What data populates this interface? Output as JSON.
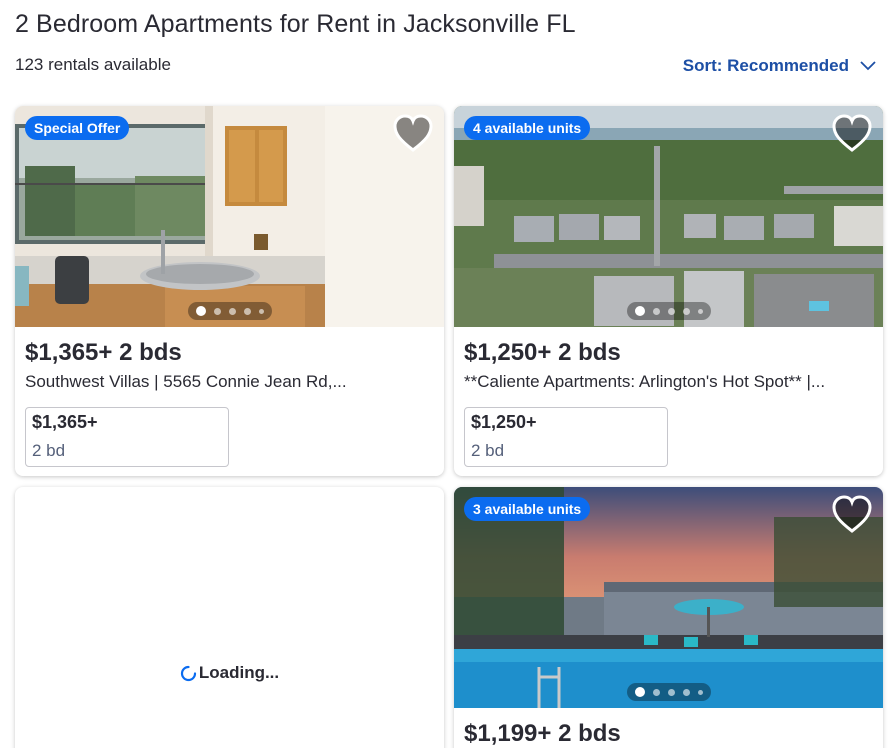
{
  "header": {
    "title": "2 Bedroom Apartments for Rent in Jacksonville FL",
    "results_count": "123 rentals available",
    "sort_label": "Sort: Recommended"
  },
  "listings": [
    {
      "badge": "Special Offer",
      "price_line": "$1,365+ 2 bds",
      "address": "Southwest Villas | 5565 Connie Jean Rd,...",
      "unit_price": "$1,365+",
      "unit_beds": "2 bd",
      "photo": "kitchen-photo"
    },
    {
      "badge": "4 available units",
      "price_line": "$1,250+ 2 bds",
      "address": "**Caliente Apartments: Arlington's Hot Spot** |...",
      "unit_price": "$1,250+",
      "unit_beds": "2 bd",
      "photo": "aerial-photo"
    },
    {
      "loading_text": "Loading..."
    },
    {
      "badge": "3 available units",
      "price_line": "$1,199+ 2 bds",
      "photo": "pool-photo"
    }
  ],
  "colors": {
    "accent": "#1d4fa5",
    "badge": "#0b6cf0",
    "text": "#2a2a33"
  },
  "icons": {
    "favorite": "heart-icon",
    "sort": "chevron-down-icon",
    "loading": "spinner-icon"
  }
}
